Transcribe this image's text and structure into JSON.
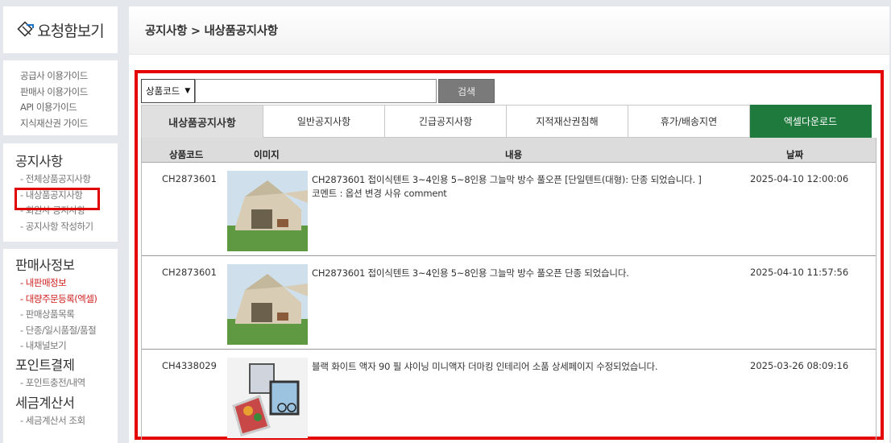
{
  "logo": {
    "text": "요청함보기"
  },
  "guides": [
    "공급사 이용가이드",
    "판매사 이용가이드",
    "API 이용가이드",
    "지식재산권 가이드"
  ],
  "notice": {
    "title": "공지사항",
    "items": [
      "- 전체상품공지사항",
      "- 내상품공지사항",
      "- 회원사 공지사항",
      "- 공지사항 작성하기"
    ]
  },
  "seller": {
    "title": "판매사정보",
    "items": [
      "- 내판매정보",
      "- 대량주문등록(엑셀)",
      "- 판매상품목록",
      "- 단종/일시품절/품절",
      "- 내채널보기"
    ]
  },
  "points": {
    "title": "포인트결제",
    "items": [
      "- 포인트충전/내역"
    ]
  },
  "tax": {
    "title": "세금계산서",
    "items": [
      "- 세금계산서 조회"
    ]
  },
  "header": {
    "title": "공지사항 > 내상품공지사항"
  },
  "search": {
    "select_value": "상품코드",
    "input_value": "",
    "button_label": "검색"
  },
  "tabs": [
    "내상품공지사항",
    "일반공지사항",
    "긴급공지사항",
    "지적재산권침해",
    "휴가/배송지연",
    "엑셀다운로드"
  ],
  "columns": [
    "상품코드",
    "이미지",
    "내용",
    "날짜"
  ],
  "rows": [
    {
      "code": "CH2873601",
      "content": "CH2873601 접이식텐트 3~4인용 5~8인용 그늘막 방수 풀오픈 [단일텐트(대형): 단종 되었습니다. ]",
      "comment": "코멘트 : 옵션 변경 사유 comment",
      "date": "2025-04-10 12:00:06"
    },
    {
      "code": "CH2873601",
      "content": "CH2873601 접이식텐트 3~4인용 5~8인용 그늘막 방수 풀오픈 단종 되었습니다.",
      "comment": "",
      "date": "2025-04-10 11:57:56"
    },
    {
      "code": "CH4338029",
      "content": "블랙 화이트 액자 90 필 샤이닝 미니액자 더마킹 인테리어 소품 상세페이지 수정되었습니다.",
      "comment": "",
      "date": "2025-03-26 08:09:16"
    }
  ],
  "colors": {
    "highlight": "#e50000",
    "excel_tab": "#1f7a3d",
    "accent_red_text": "#d02020"
  }
}
